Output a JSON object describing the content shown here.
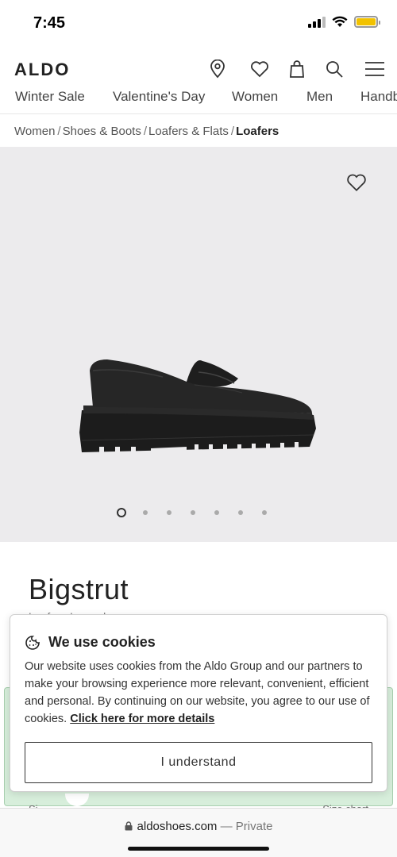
{
  "status_bar": {
    "time": "7:45"
  },
  "header": {
    "logo": "ALDO",
    "icons": [
      "location-icon",
      "heart-icon",
      "bag-icon",
      "search-icon",
      "menu-icon"
    ]
  },
  "nav": {
    "items": [
      "Winter Sale",
      "Valentine's Day",
      "Women",
      "Men",
      "Handb"
    ]
  },
  "breadcrumb": {
    "items": [
      "Women",
      "Shoes & Boots",
      "Loafers & Flats"
    ],
    "current": "Loafers",
    "separator": "/"
  },
  "gallery": {
    "image_count": 7,
    "active_index": 0
  },
  "product": {
    "name": "Bigstrut",
    "subtitle": "Loafer - Lug sole"
  },
  "cookie_banner": {
    "title": "We use cookies",
    "body": "Our website uses cookies from the Aldo Group and our partners to make your browsing experience more relevant, convenient, efficient and personal. By continuing on our website, you agree to our use of cookies. ",
    "link": "Click here for more details",
    "button": "I understand"
  },
  "below_cut": {
    "left": "Si",
    "right": "Size chart"
  },
  "browser": {
    "domain": "aldoshoes.com",
    "mode": "— Private"
  },
  "colors": {
    "gallery_bg": "#ecebed",
    "offer_bg": "#d7eedb",
    "battery": "#f2c200"
  }
}
